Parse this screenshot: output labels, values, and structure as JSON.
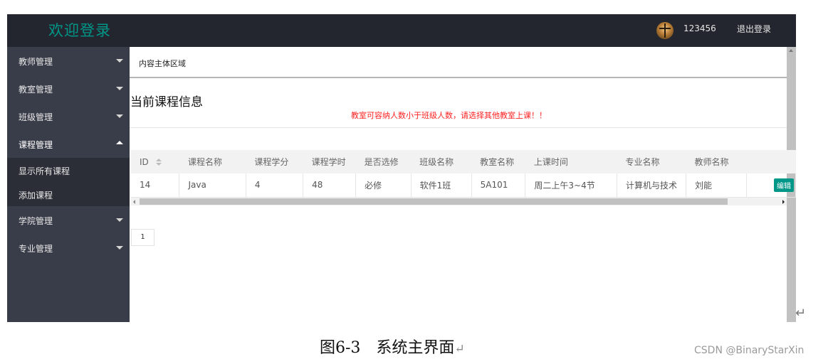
{
  "header": {
    "title": "欢迎登录",
    "username": "123456",
    "logout_label": "退出登录",
    "avatar_icon": "user-avatar",
    "bg_color": "#23262e",
    "title_color": "#009688"
  },
  "sidebar": {
    "items": [
      {
        "label": "教师管理",
        "expanded": false
      },
      {
        "label": "教室管理",
        "expanded": false
      },
      {
        "label": "班级管理",
        "expanded": false
      },
      {
        "label": "课程管理",
        "expanded": true
      },
      {
        "label": "学院管理",
        "expanded": false
      },
      {
        "label": "专业管理",
        "expanded": false
      }
    ],
    "sub_items": [
      "显示所有课程",
      "添加课程"
    ]
  },
  "content": {
    "tab_label": "内容主体区域",
    "page_title": "当前课程信息",
    "warning": "教室可容纳人数小于班级人数，请选择其他教室上课！！",
    "warning_color": "#ff2222"
  },
  "table": {
    "columns": [
      "ID",
      "课程名称",
      "课程学分",
      "课程学时",
      "是否选修",
      "班级名称",
      "教室名称",
      "上课时间",
      "专业名称",
      "教师名称",
      ""
    ],
    "rows": [
      [
        "14",
        "Java",
        "4",
        "48",
        "必修",
        "软件1班",
        "5A101",
        "周二上午3~4节",
        "计算机与技术",
        "刘能",
        ""
      ]
    ],
    "edit_label": "编辑",
    "edit_color": "#009688"
  },
  "pagination": {
    "current_page": "1"
  },
  "caption": {
    "text": "图6-3　系统主界面",
    "return_mark": "↵"
  },
  "watermark": "CSDN @BinaryStarXin"
}
